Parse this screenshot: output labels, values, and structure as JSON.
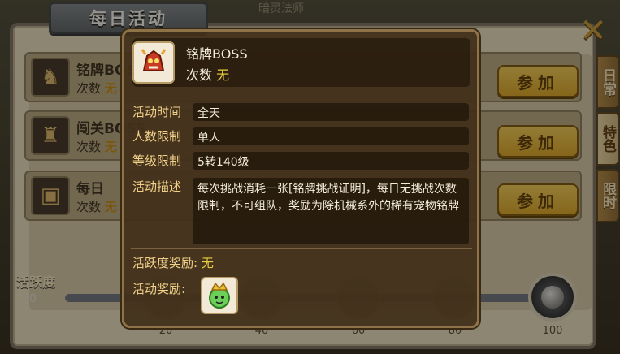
{
  "panel": {
    "title": "每日活动",
    "top_hint": "暗灵法师"
  },
  "side_tabs": [
    {
      "label": "日常",
      "active": false
    },
    {
      "label": "特色",
      "active": true
    },
    {
      "label": "限时",
      "active": false
    }
  ],
  "rows": [
    {
      "name": "铭牌BOSS",
      "count_label": "次数",
      "count_value": "无",
      "button": "参加"
    },
    {
      "name": "闯关BOSS",
      "count_label": "次数",
      "count_value": "无",
      "button": "参加"
    },
    {
      "name": "每日",
      "count_label": "次数",
      "count_value": "无",
      "button": "参加"
    }
  ],
  "activity": {
    "label": "活跃度",
    "value": "0",
    "progress": 0,
    "ticks": [
      "20",
      "40",
      "60",
      "80",
      "100"
    ]
  },
  "tooltip": {
    "name": "铭牌BOSS",
    "count_label": "次数",
    "count_value": "无",
    "time_label": "活动时间",
    "time_value": "全天",
    "players_label": "人数限制",
    "players_value": "单人",
    "level_label": "等级限制",
    "level_value": "5转140级",
    "desc_label": "活动描述",
    "desc_value": "每次挑战消耗一张[铭牌挑战证明]，每日无挑战次数限制，不可组队，奖励为除机械系外的稀有宠物铭牌",
    "activity_reward_label": "活跃度奖励:",
    "activity_reward_value": "无",
    "reward_label": "活动奖励:"
  },
  "icons": {
    "close": "close-icon",
    "boss": "dragon-boss-icon",
    "reward": "pet-reward-icon"
  },
  "colors": {
    "accent_gold": "#e8d040",
    "button_gold": "#d9a628",
    "parchment": "#e5dcc2"
  }
}
